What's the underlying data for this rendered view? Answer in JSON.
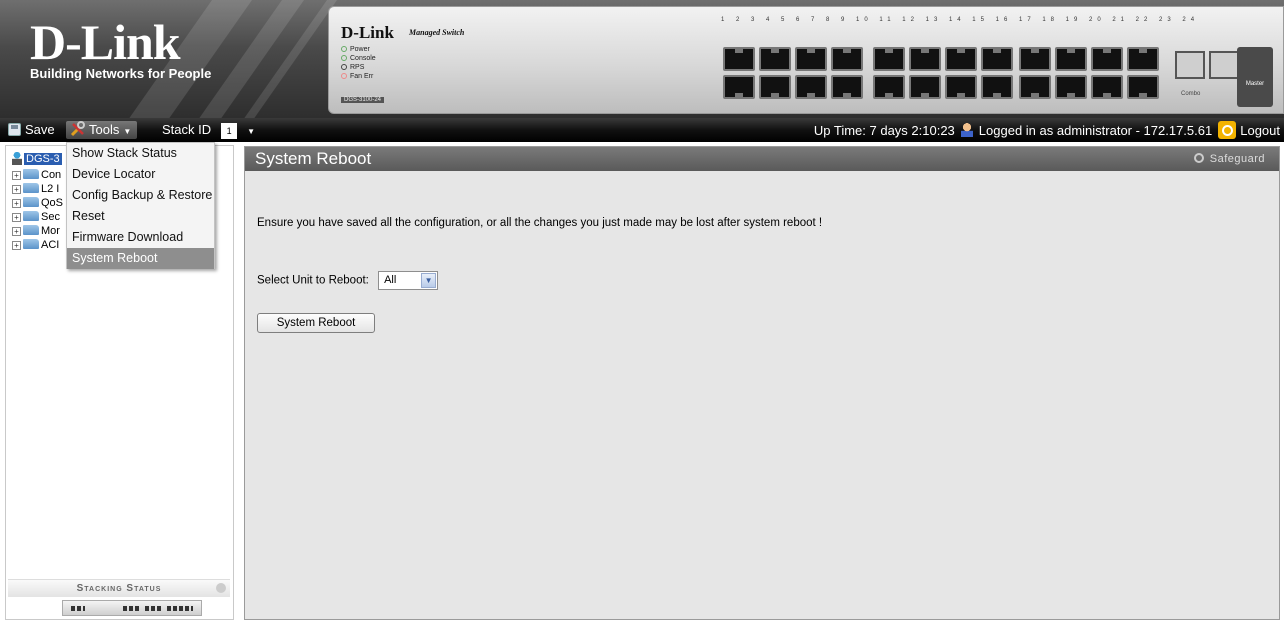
{
  "header": {
    "brand": "D-Link",
    "tagline": "Building Networks for People",
    "device_brand": "D-Link",
    "device_subtitle": "Managed Switch",
    "device_leds": [
      "Power",
      "Console",
      "RPS",
      "Fan Err"
    ],
    "device_model": "DGS-3100-24",
    "port_numbers_top": "1 2 3 4 5 6 7 8  9 10 11 12 13 14 15 16  17 18 19 20 21 22 23 24",
    "combo_label": "Combo",
    "master_label": "Master"
  },
  "toolbar": {
    "save_label": "Save",
    "tools_label": "Tools",
    "stack_id_label": "Stack ID",
    "stack_id_value": "1",
    "uptime": "Up Time: 7 days 2:10:23",
    "logged_in": "Logged in as administrator - 172.17.5.61",
    "logout_label": "Logout"
  },
  "tools_menu": {
    "items": [
      {
        "label": "Show Stack Status"
      },
      {
        "label": "Device Locator"
      },
      {
        "label": "Config Backup & Restore"
      },
      {
        "label": "Reset"
      },
      {
        "label": "Firmware Download"
      },
      {
        "label": "System Reboot",
        "active": true
      }
    ]
  },
  "sidebar": {
    "root_label": "DGS-3",
    "nodes": [
      {
        "label": "Con"
      },
      {
        "label": "L2 I"
      },
      {
        "label": "QoS"
      },
      {
        "label": "Sec"
      },
      {
        "label": "Mor"
      },
      {
        "label": "ACI"
      }
    ],
    "stacking_status_label": "Stacking Status"
  },
  "main": {
    "title": "System Reboot",
    "safeguard_label": "Safeguard",
    "warning_text": "Ensure you have saved all the configuration, or all the changes you just made may be lost after system reboot !",
    "unit_label": "Select Unit to Reboot:",
    "unit_value": "All",
    "reboot_button": "System Reboot"
  },
  "colors": {
    "toolbar_bg": "#000000",
    "panel_header": "#666666",
    "panel_bg": "#e6e6e6",
    "tree_selected": "#2a5db0",
    "menu_active": "#8e8e8e"
  }
}
